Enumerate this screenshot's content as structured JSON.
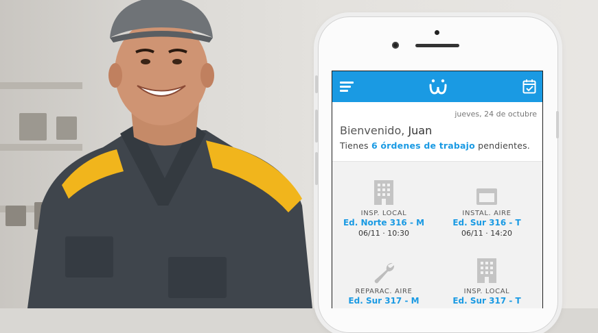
{
  "header": {
    "menu_icon": "hamburger-menu-icon",
    "logo_icon": "w-logo-icon",
    "calendar_icon": "calendar-check-icon",
    "accent_color": "#1a9ae3"
  },
  "welcome": {
    "date": "jueves, 24 de octubre",
    "greeting": "Bienvenido,",
    "user_name": "Juan",
    "pending_prefix": "Tienes",
    "pending_highlight": "6 órdenes de trabajo",
    "pending_suffix": "pendientes."
  },
  "orders": [
    {
      "icon": "building-icon",
      "type": "INSP. LOCAL",
      "place": "Ed. Norte 316 - M",
      "time": "06/11 · 10:30"
    },
    {
      "icon": "air-unit-icon",
      "type": "INSTAL. AIRE",
      "place": "Ed. Sur 316 - T",
      "time": "06/11 · 14:20"
    },
    {
      "icon": "wrench-icon",
      "type": "REPARAC. AIRE",
      "place": "Ed. Sur 317 - M",
      "time": ""
    },
    {
      "icon": "building-icon",
      "type": "INSP. LOCAL",
      "place": "Ed. Sur 317 - T",
      "time": ""
    }
  ]
}
